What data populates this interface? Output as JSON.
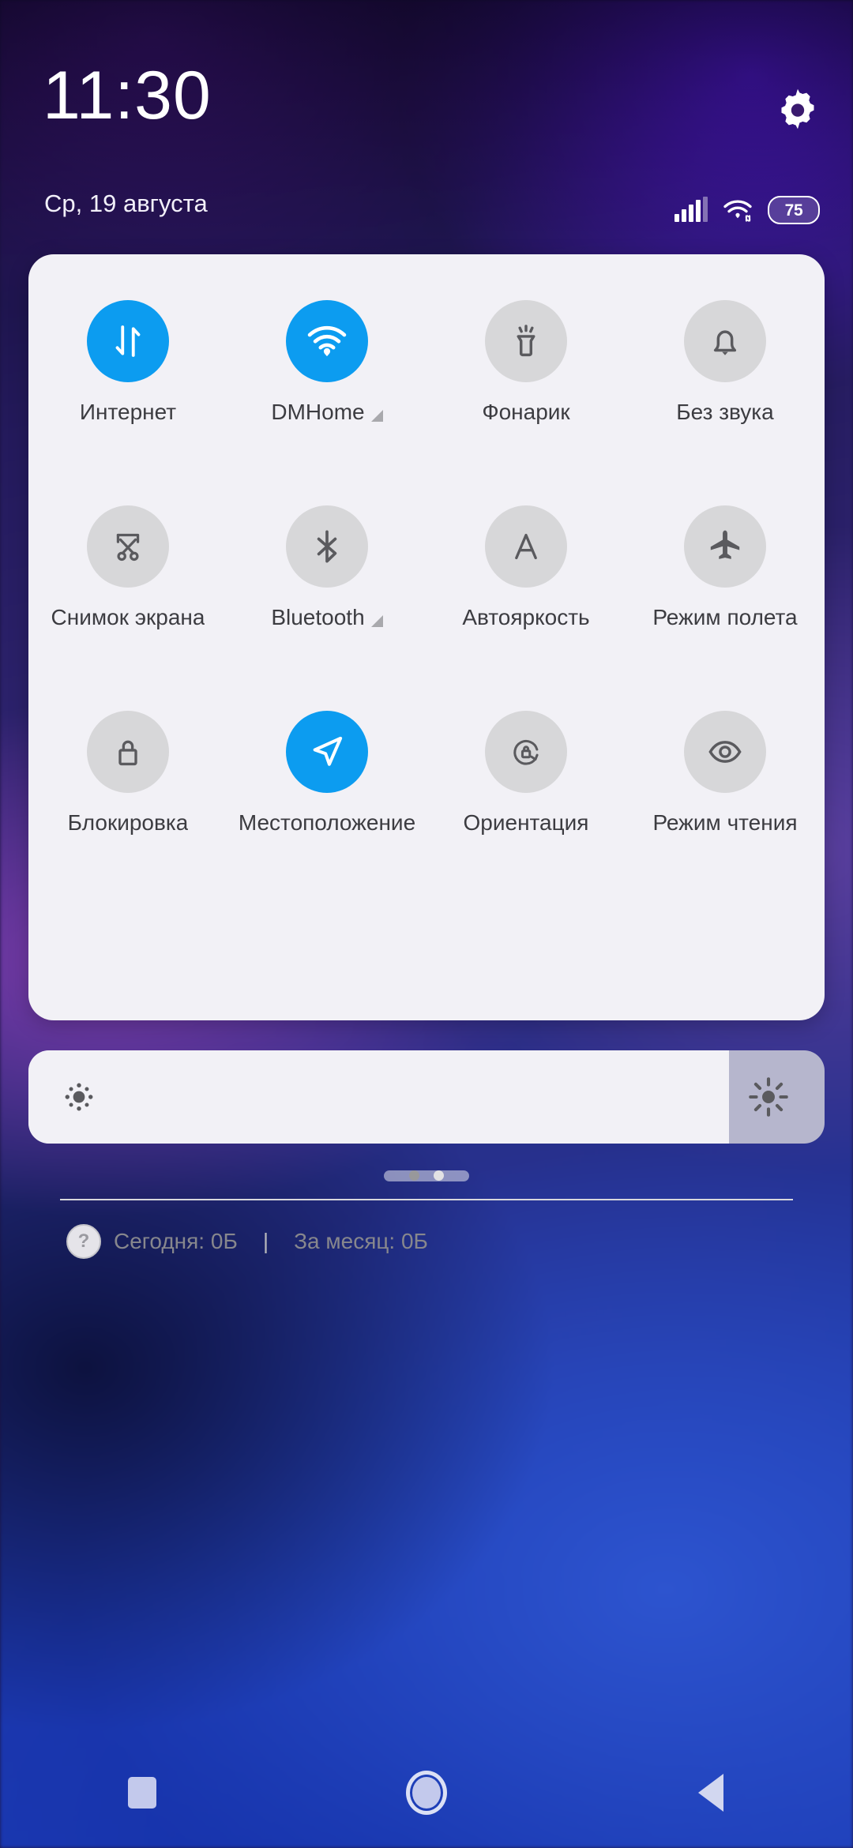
{
  "statusbar": {
    "clock": "11:30",
    "date": "Ср, 19 августа",
    "gear_icon": "gear-icon",
    "signal_icon": "signal-bars-icon",
    "signal_bars_total": 5,
    "signal_bars_filled": 4,
    "wifi_icon": "wifi-icon",
    "battery_level": "75",
    "battery_icon": "battery-icon"
  },
  "quick_settings": {
    "tiles": [
      {
        "label": "Интернет",
        "icon": "data-transfer-icon",
        "active": true,
        "expandable": false
      },
      {
        "label": "DMHome",
        "icon": "wifi-icon",
        "active": true,
        "expandable": true
      },
      {
        "label": "Фонарик",
        "icon": "flashlight-icon",
        "active": false,
        "expandable": false
      },
      {
        "label": "Без звука",
        "icon": "bell-icon",
        "active": false,
        "expandable": false
      },
      {
        "label": "Снимок экрана",
        "icon": "scissors-icon",
        "active": false,
        "expandable": false
      },
      {
        "label": "Bluetooth",
        "icon": "bluetooth-icon",
        "active": false,
        "expandable": true
      },
      {
        "label": "Автояркость",
        "icon": "auto-brightness-icon",
        "active": false,
        "expandable": false
      },
      {
        "label": "Режим полета",
        "icon": "airplane-icon",
        "active": false,
        "expandable": false
      },
      {
        "label": "Блокировка",
        "icon": "lock-icon",
        "active": false,
        "expandable": false
      },
      {
        "label": "Местоположение",
        "icon": "location-arrow-icon",
        "active": true,
        "expandable": false
      },
      {
        "label": "Ориентация",
        "icon": "rotation-lock-icon",
        "active": false,
        "expandable": false
      },
      {
        "label": "Режим чтения",
        "icon": "eye-icon",
        "active": false,
        "expandable": false
      }
    ],
    "pages": {
      "count": 2,
      "current": 1
    },
    "data_usage": {
      "help_icon": "question-mark-icon",
      "today": "Сегодня: 0Б",
      "separator": "|",
      "month": "За месяц: 0Б"
    }
  },
  "brightness": {
    "low_icon": "brightness-low-icon",
    "high_icon": "brightness-high-icon",
    "value_percent": 88
  },
  "drag_handle": "panel-drag-handle",
  "navbar": {
    "recents_icon": "recents-square-icon",
    "home_icon": "home-circle-icon",
    "back_icon": "back-triangle-icon"
  },
  "colors": {
    "accent_active": "#0c9cf0",
    "tile_inactive": "#d7d7d9",
    "panel_bg": "#f2f1f6",
    "icon_gray": "#5a5a5e"
  }
}
